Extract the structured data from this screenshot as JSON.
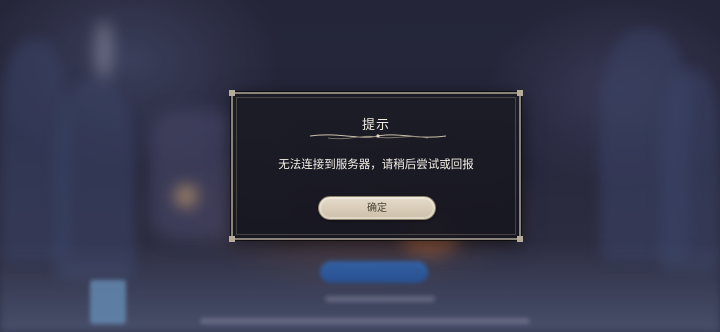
{
  "dialog": {
    "title": "提示",
    "message": "无法连接到服务器，请稍后尝试或回报",
    "confirm_label": "确定"
  },
  "colors": {
    "dialog_bg": "#1c1c26",
    "dialog_border": "#8a8478",
    "button_bg": "#e6dccb",
    "button_text": "#4a4236",
    "text": "#f2ecdf"
  },
  "icons": [
    "title-flourish-icon"
  ]
}
